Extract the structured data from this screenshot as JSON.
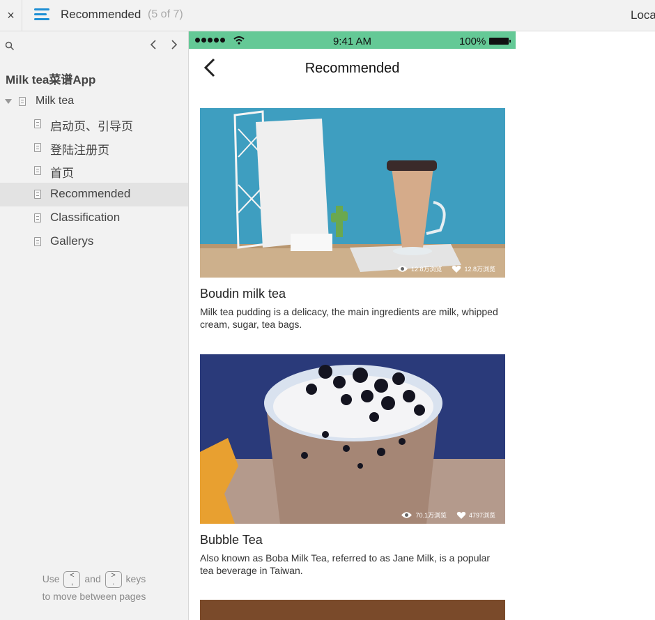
{
  "topbar": {
    "close_glyph": "×",
    "page_title": "Recommended",
    "page_count": "(5 of 7)",
    "right_text": "Loca"
  },
  "sidebar": {
    "project_title": "Milk tea菜谱App",
    "folder_label": "Milk tea",
    "items": [
      {
        "label": "启动页、引导页"
      },
      {
        "label": "登陆注册页"
      },
      {
        "label": "首页"
      },
      {
        "label": "Recommended",
        "active": true
      },
      {
        "label": "Classification"
      },
      {
        "label": "Gallerys"
      }
    ],
    "hint": {
      "use": "Use",
      "key_prev": "<\n,",
      "and": "and",
      "key_next": ">\n.",
      "keys": "keys",
      "line2": "to move between pages"
    }
  },
  "phone": {
    "status": {
      "time": "9:41 AM",
      "battery": "100%"
    },
    "nav_title": "Recommended",
    "cards": [
      {
        "title": "Boudin milk tea",
        "desc": "Milk tea pudding is a delicacy, the main ingredients are milk, whipped cream, sugar, tea bags.",
        "views": "12.8万浏览",
        "likes": "12.8万浏览"
      },
      {
        "title": "Bubble Tea",
        "desc": "Also known as Boba Milk Tea, referred to as Jane Milk, is a popular tea beverage in Taiwan.",
        "views": "70.1万浏览",
        "likes": "4797浏览"
      }
    ]
  },
  "colors": {
    "status_bar": "#64c996",
    "menu_icon": "#1e8fd4",
    "sidebar_bg": "#f2f2f2",
    "active_row": "#e3e3e3"
  }
}
